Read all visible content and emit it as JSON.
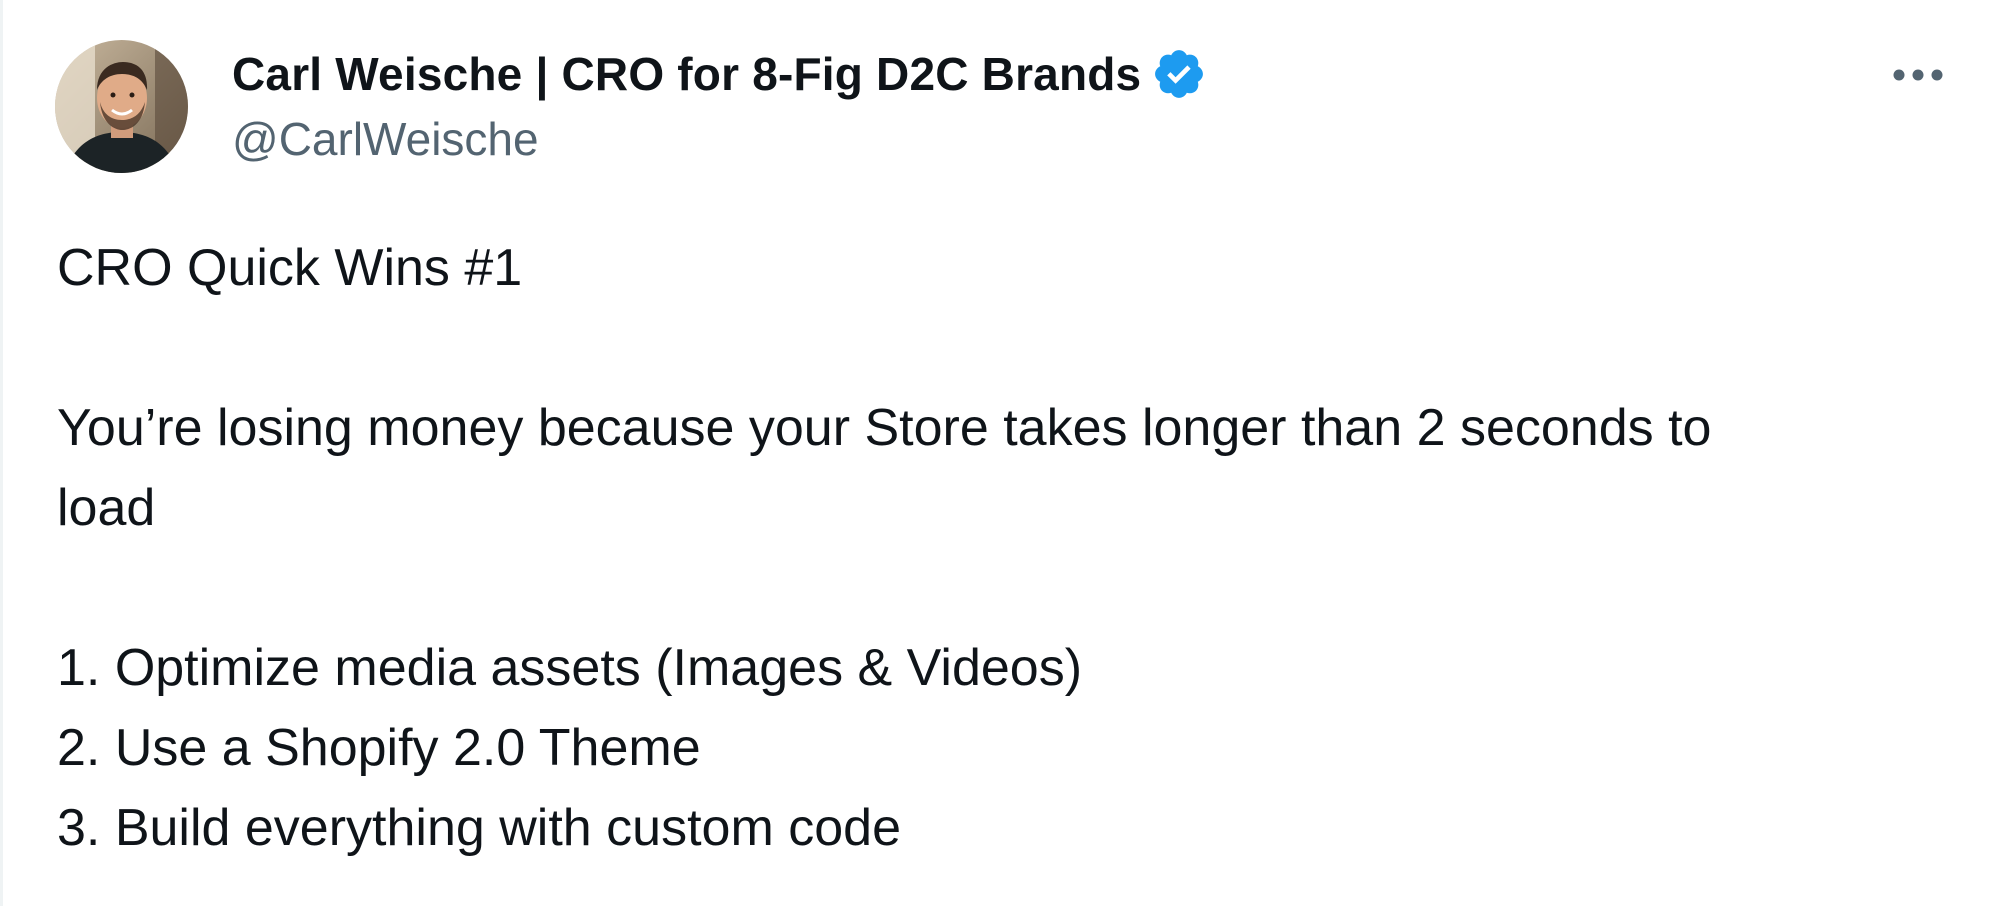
{
  "author": {
    "display_name": "Carl Weische | CRO for 8-Fig D2C Brands",
    "handle": "@CarlWeische",
    "verified": true,
    "verified_color": "#1d9bf0",
    "avatar_icon": "profile-photo"
  },
  "menu": {
    "icon": "more-horizontal-icon"
  },
  "tweet": {
    "title_line": "CRO Quick Wins #1",
    "intro_line1": "You’re losing money because your Store takes longer than 2 seconds to",
    "intro_line2": "load",
    "items": [
      "1. Optimize media assets (Images & Videos)",
      "2. Use a Shopify 2.0 Theme",
      "3. Build everything with custom code"
    ]
  },
  "colors": {
    "text_primary": "#0f1419",
    "text_secondary": "#536471",
    "background": "#ffffff"
  }
}
